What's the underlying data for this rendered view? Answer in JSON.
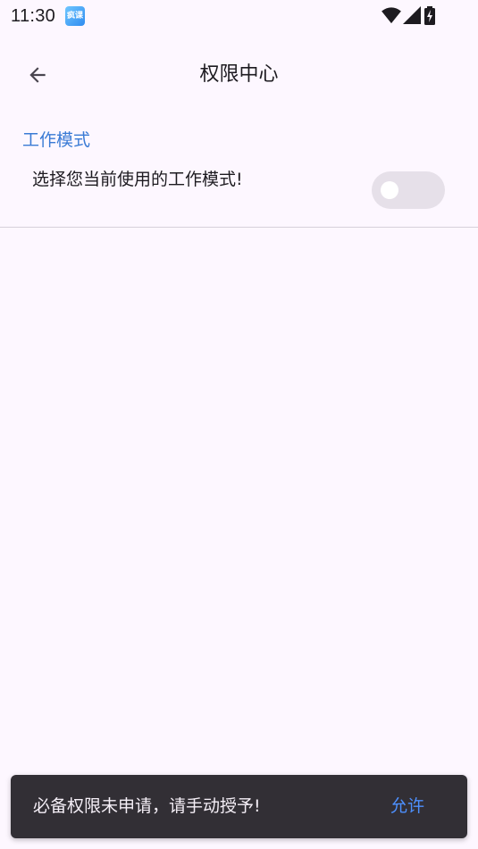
{
  "status_bar": {
    "time": "11:30",
    "app_icon_text": "疯课",
    "icons": [
      "wifi-icon",
      "cellular-signal-icon",
      "battery-charging-icon"
    ]
  },
  "app_bar": {
    "back_icon": "arrow-back-icon",
    "title": "权限中心"
  },
  "section": {
    "header": "工作模式",
    "item_label": "选择您当前使用的工作模式!",
    "switch_on": false
  },
  "snackbar": {
    "message": "必备权限未申请，请手动授予!",
    "action": "允许"
  },
  "colors": {
    "background": "#FDF7FF",
    "accent": "#3A7BD5",
    "snackbar_bg": "#322F35",
    "snackbar_action": "#4D90FE",
    "switch_track": "#E6E0E9"
  }
}
